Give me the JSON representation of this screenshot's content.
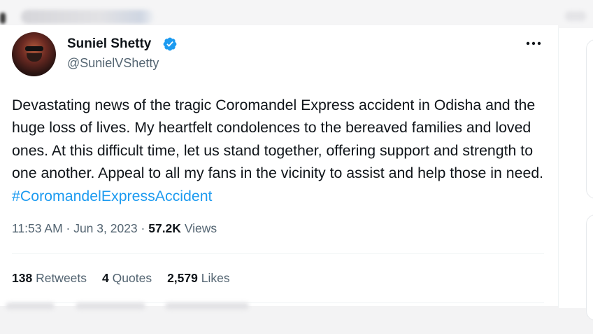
{
  "tweet": {
    "author": {
      "display_name": "Suniel Shetty",
      "handle": "@SunielVShetty",
      "verified": true,
      "avatar_icon": "profile-photo"
    },
    "text_parts": [
      "Devastating news of the tragic Coromandel Express accident in Odisha and the huge loss of lives. My heartfelt condolences to the bereaved families and loved ones. At this difficult time, let us stand together, offering support and strength to one another. Appeal to all my fans in the vicinity to assist and help those in need. "
    ],
    "hashtag": "#CoromandelExpressAccident",
    "time": "11:53 AM",
    "date": "Jun 3, 2023",
    "views_count": "57.2K",
    "views_label": "Views",
    "stats": {
      "retweets_count": "138",
      "retweets_label": "Retweets",
      "quotes_count": "4",
      "quotes_label": "Quotes",
      "likes_count": "2,579",
      "likes_label": "Likes"
    }
  },
  "colors": {
    "accent": "#1d9bf0",
    "text_primary": "#0f1419",
    "text_secondary": "#536471",
    "divider": "#eff3f4"
  }
}
